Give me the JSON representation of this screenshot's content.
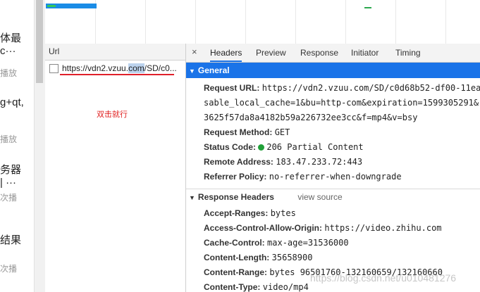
{
  "left_panel": {
    "items": [
      {
        "title": "体最",
        "sub": ""
      },
      {
        "title": "c···",
        "sub": "播放"
      },
      {
        "title": "g+qt,",
        "sub": "播放"
      },
      {
        "title": "务器",
        "sub": ""
      },
      {
        "title": "| ···",
        "sub": "次播"
      },
      {
        "title": "结果",
        "sub": "次播"
      }
    ]
  },
  "requests": {
    "column_header": "Url",
    "rows": [
      {
        "url_pre": "https://vdn2.vzuu.",
        "url_hl": "com",
        "url_post": "/SD/c0..."
      }
    ],
    "annotation": "双击就行"
  },
  "details": {
    "close_icon": "×",
    "tabs": [
      "Headers",
      "Preview",
      "Response",
      "Initiator",
      "Timing"
    ],
    "general": {
      "title": "General",
      "request_url_label": "Request URL:",
      "request_url_lines": [
        "https://vdn2.vzuu.com/SD/c0d68b52-df00-11ea",
        "sable_local_cache=1&bu=http-com&expiration=1599305291&",
        "3625f57da8a4182b59a226732ee3cc&f=mp4&v=bsy"
      ],
      "request_method_label": "Request Method:",
      "request_method": "GET",
      "status_code_label": "Status Code:",
      "status_code": "206 Partial Content",
      "status_color": "#20a038",
      "remote_address_label": "Remote Address:",
      "remote_address": "183.47.233.72:443",
      "referrer_policy_label": "Referrer Policy:",
      "referrer_policy": "no-referrer-when-downgrade"
    },
    "response_headers": {
      "title": "Response Headers",
      "view_source": "view source",
      "items": [
        {
          "k": "Accept-Ranges:",
          "v": "bytes"
        },
        {
          "k": "Access-Control-Allow-Origin:",
          "v": "https://video.zhihu.com"
        },
        {
          "k": "Cache-Control:",
          "v": "max-age=31536000"
        },
        {
          "k": "Content-Length:",
          "v": "35658900"
        },
        {
          "k": "Content-Range:",
          "v": "bytes 96501760-132160659/132160660"
        },
        {
          "k": "Content-Type:",
          "v": "video/mp4"
        }
      ]
    }
  },
  "watermark": "https://blog.csdn.net/u010481276"
}
